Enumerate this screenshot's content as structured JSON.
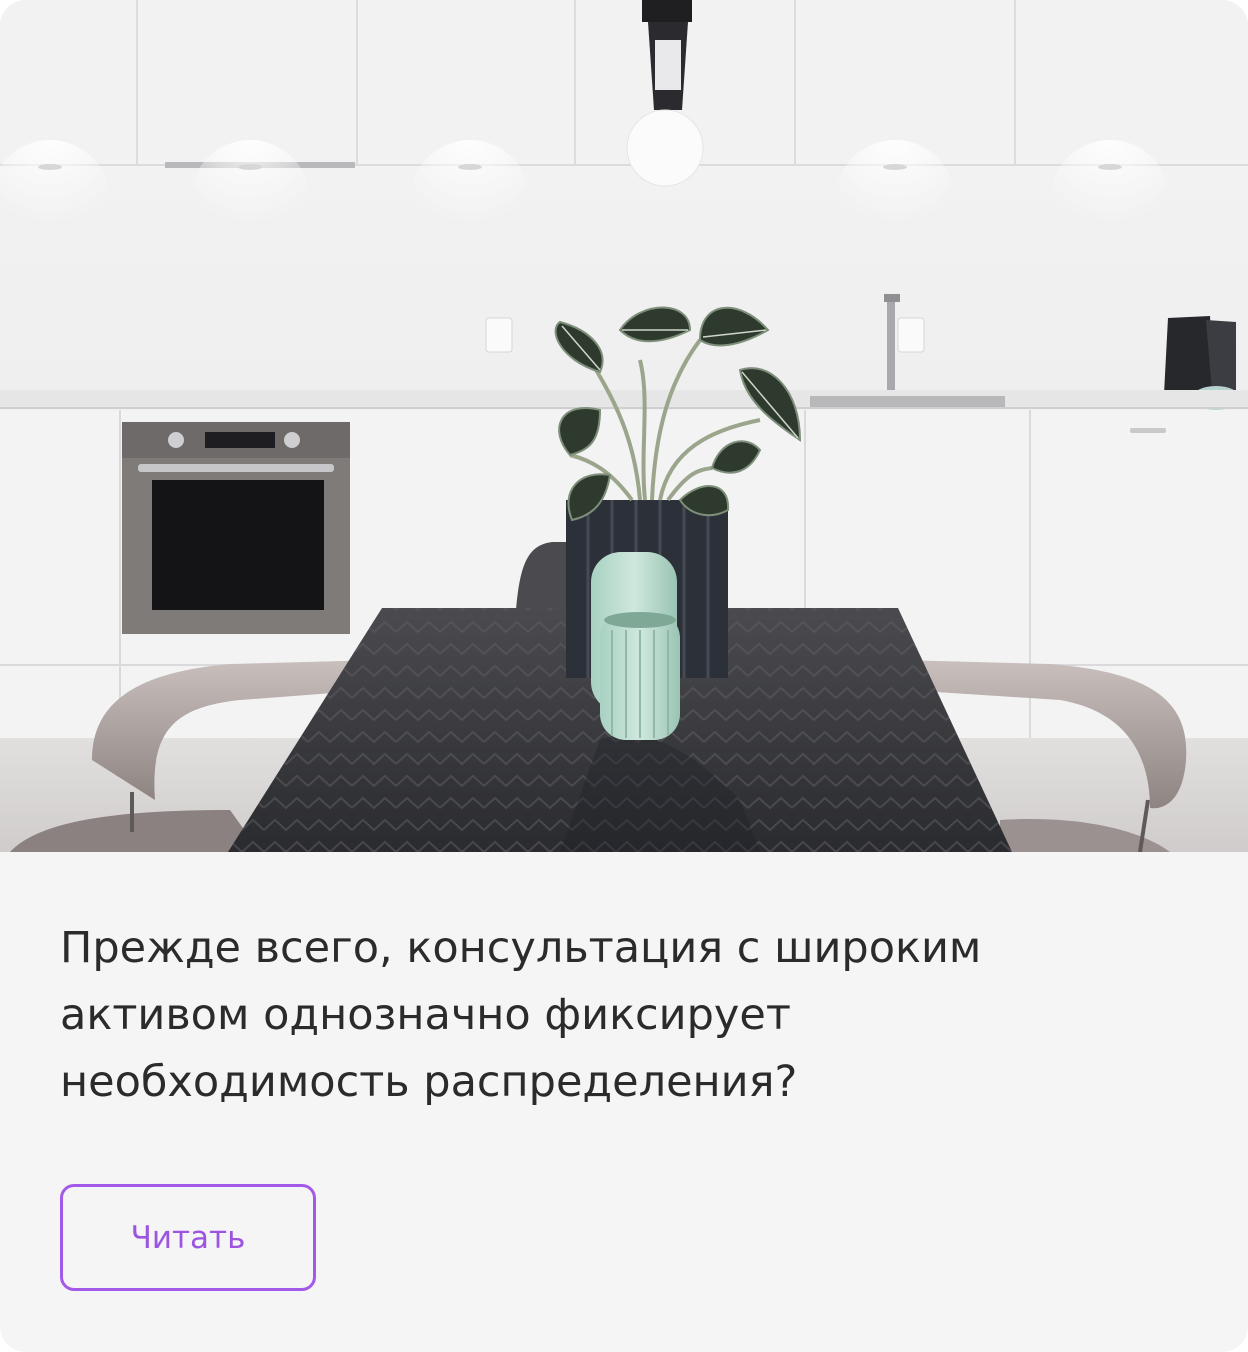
{
  "card": {
    "image_alt": "Kitchen interior with dining table and plant",
    "text": "Прежде всего, консультация с широким активом однозначно фиксирует необходимость распределения?",
    "button_label": "Читать"
  },
  "colors": {
    "card_background": "#f5f5f5",
    "text": "#2b2b2b",
    "accent": "#a35ae8"
  }
}
